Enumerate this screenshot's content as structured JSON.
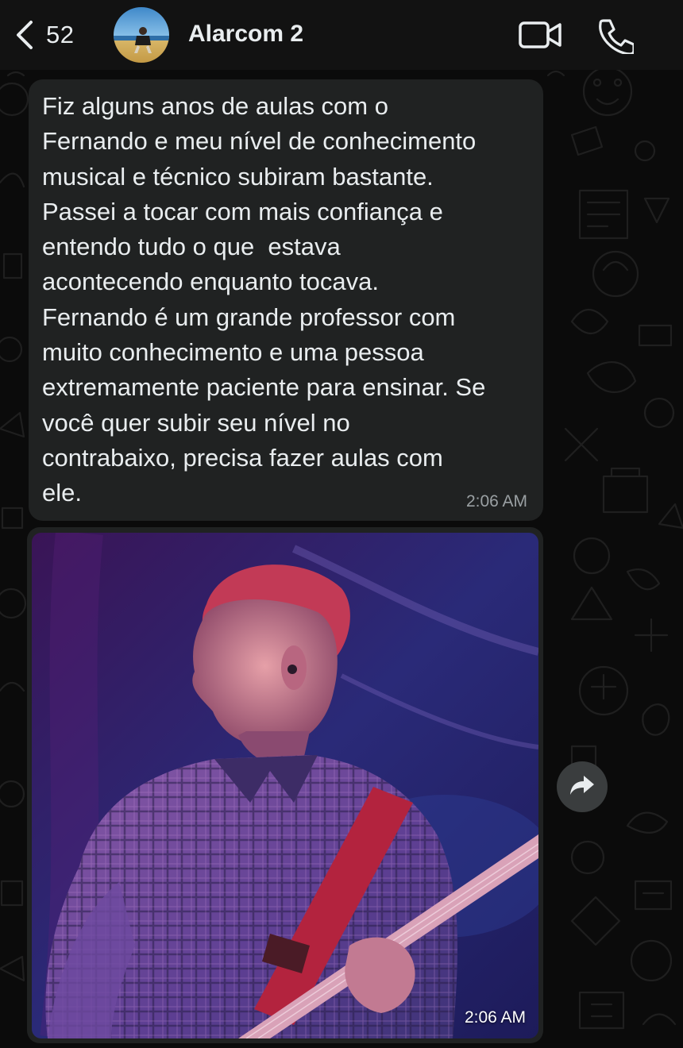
{
  "header": {
    "unread_count": "52",
    "contact_name": "Alarcom 2",
    "icons": {
      "back": "chevron-left-icon",
      "video_call": "video-camera-icon",
      "voice_call": "phone-icon"
    }
  },
  "messages": [
    {
      "type": "text",
      "text": "Fiz alguns anos de aulas com o\nFernando e meu nível de conhecimento\nmusical e técnico subiram bastante.\nPassei a tocar com mais confiança e\nentendo tudo o que  estava\nacontecendo enquanto tocava.\nFernando é um grande professor com\nmuito conhecimento e uma pessoa\nextremamente paciente para ensinar. Se\nvocê quer subir seu nível no\ncontrabaixo, precisa fazer aulas com\nele.",
      "time": "2:06 AM"
    },
    {
      "type": "image",
      "time": "2:06 AM",
      "forward_icon": "forward-arrow-icon"
    }
  ],
  "colors": {
    "header_bg": "#121212",
    "chat_bg": "#0b0b0b",
    "bubble_bg": "#202222",
    "text": "#e9edef",
    "timestamp": "#9aa0a3"
  }
}
